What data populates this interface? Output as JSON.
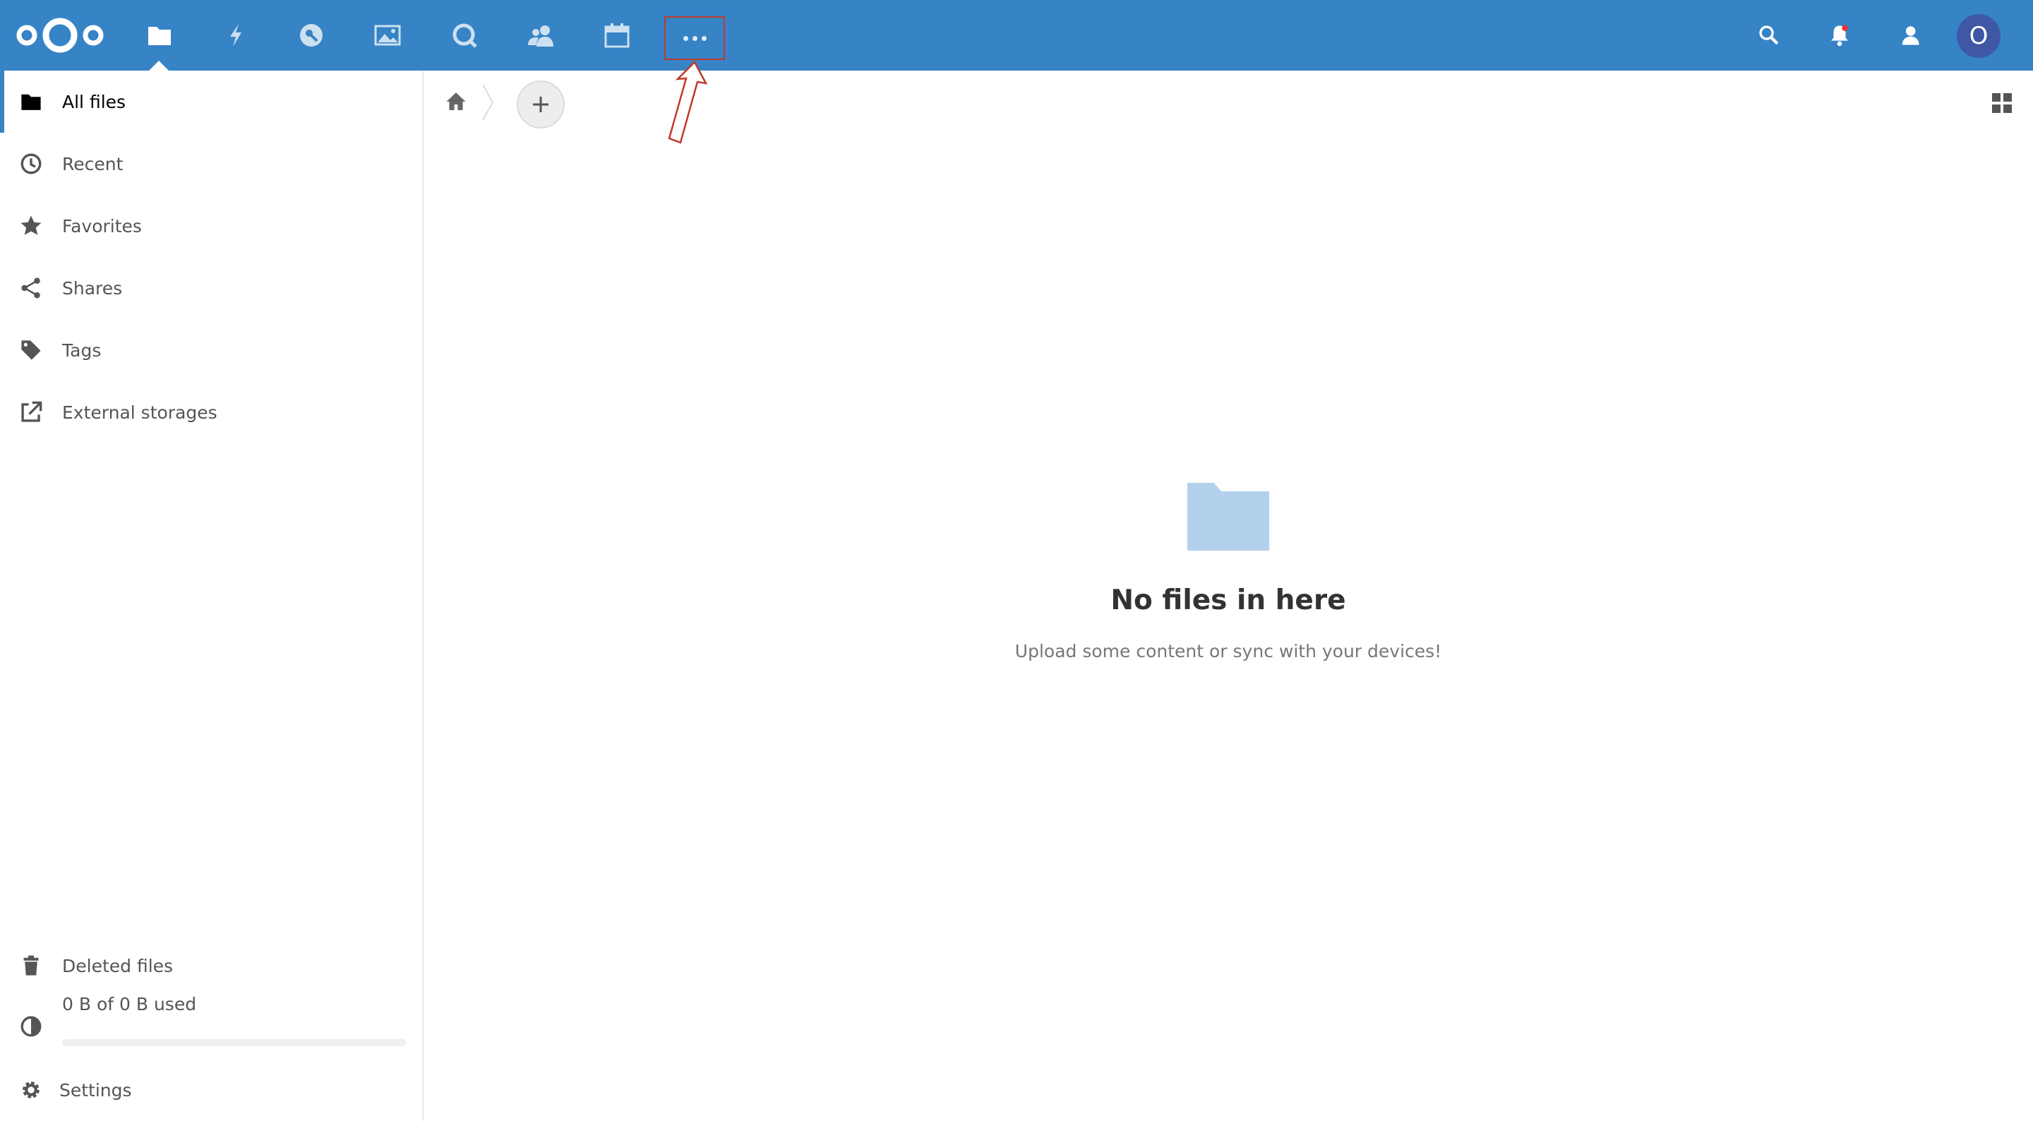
{
  "header": {
    "apps": [
      {
        "name": "files",
        "icon": "folder-icon",
        "active": true
      },
      {
        "name": "activity",
        "icon": "lightning-icon"
      },
      {
        "name": "passwords",
        "icon": "key-icon"
      },
      {
        "name": "gallery",
        "icon": "image-icon"
      },
      {
        "name": "talk",
        "icon": "chat-bubble-icon"
      },
      {
        "name": "contacts",
        "icon": "contacts-icon"
      },
      {
        "name": "calendar",
        "icon": "calendar-icon"
      },
      {
        "name": "more",
        "icon": "more-dots-icon"
      }
    ],
    "right_icons": [
      "search-icon",
      "bell-icon",
      "contacts-menu-icon"
    ],
    "avatar_initial": "O",
    "brand_color": "#3683c6",
    "annotation_color": "#c0392b"
  },
  "sidebar": {
    "items": [
      {
        "label": "All files",
        "icon": "folder-icon",
        "active": true
      },
      {
        "label": "Recent",
        "icon": "clock-icon"
      },
      {
        "label": "Favorites",
        "icon": "star-icon"
      },
      {
        "label": "Shares",
        "icon": "share-icon"
      },
      {
        "label": "Tags",
        "icon": "tag-icon"
      },
      {
        "label": "External storages",
        "icon": "external-link-icon"
      }
    ],
    "bottom": {
      "deleted": "Deleted files",
      "quota": "0 B of 0 B used",
      "quota_fraction": 0,
      "settings": "Settings"
    }
  },
  "main": {
    "empty_title": "No files in here",
    "empty_subtitle": "Upload some content or sync with your devices!",
    "folder_color": "#b3d1ec"
  }
}
